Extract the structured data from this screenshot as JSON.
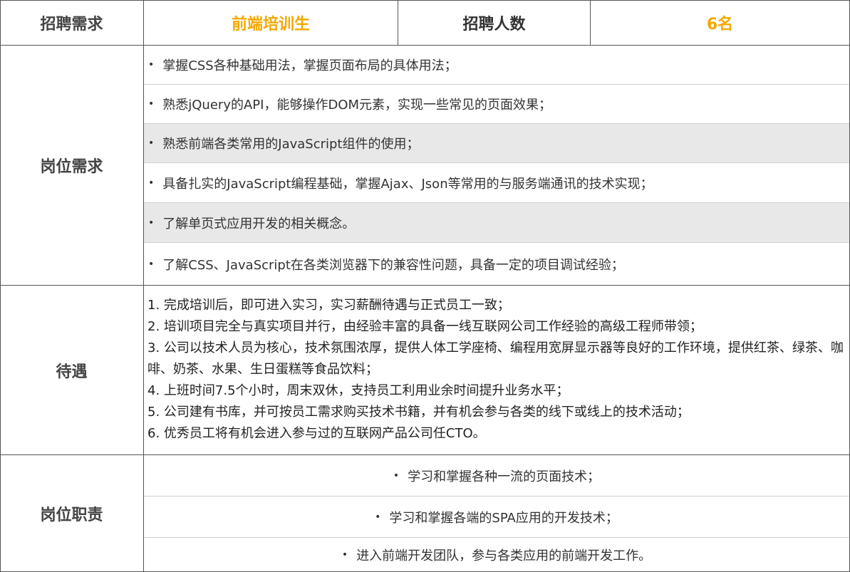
{
  "header": {
    "label_demand": "招聘需求",
    "position_name": "前端培训生",
    "label_count": "招聘人数",
    "count_value": "6名"
  },
  "requirements": {
    "label": "岗位需求",
    "items": [
      "掌握CSS各种基础用法，掌握页面布局的具体用法；",
      "熟悉jQuery的API，能够操作DOM元素，实现一些常见的页面效果；",
      "熟悉前端各类常用的JavaScript组件的使用；",
      "具备扎实的JavaScript编程基础，掌握Ajax、Json等常用的与服务端通讯的技术实现；",
      "了解单页式应用开发的相关概念。",
      "了解CSS、JavaScript在各类浏览器下的兼容性问题，具备一定的项目调试经验；"
    ]
  },
  "benefits": {
    "label": "待遇",
    "items": [
      "1.  完成培训后，即可进入实习，实习薪酬待遇与正式员工一致；",
      "2.  培训项目完全与真实项目并行，由经验丰富的具备一线互联网公司工作经验的高级工程师带领；",
      "3.  公司以技术人员为核心，技术氛围浓厚，提供人体工学座椅、编程用宽屏显示器等良好的工作环境，提供红茶、绿茶、咖啡、奶茶、水果、生日蛋糕等食品饮料；",
      "4.  上班时间7.5个小时，周末双休，支持员工利用业余时间提升业务水平；",
      "5.  公司建有书库，并可按员工需求购买技术书籍，并有机会参与各类的线下或线上的技术活动；",
      "6.  优秀员工将有机会进入参与过的互联网产品公司任CTO。"
    ]
  },
  "duties": {
    "label": "岗位职责",
    "items": [
      "学习和掌握各种一流的页面技术；",
      "学习和掌握各端的SPA应用的开发技术；",
      "进入前端开发团队，参与各类应用的前端开发工作。"
    ]
  },
  "bullet_char": "•",
  "colors": {
    "accent": "#f5a800",
    "row_gray": "#e8e8e8",
    "border": "#555555"
  }
}
